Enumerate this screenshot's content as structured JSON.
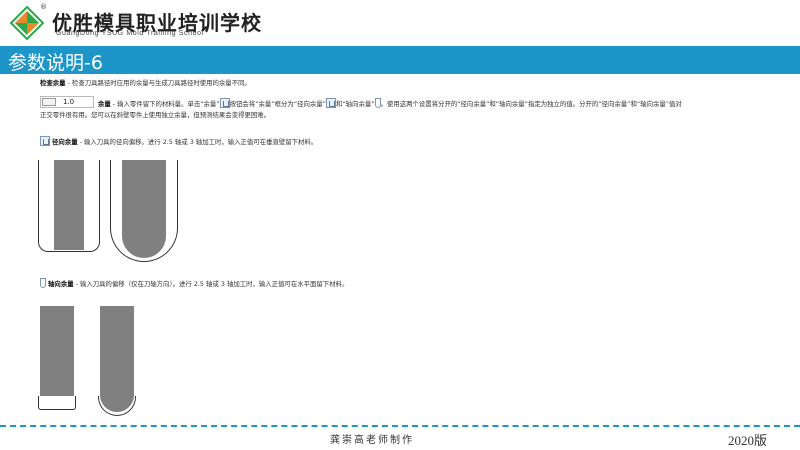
{
  "header": {
    "school_name": "优胜模具职业培训学校",
    "school_subtitle": "GuangDong YSUG Mold Training School",
    "registered_mark": "®",
    "logo_icon": "ysug-logo-icon"
  },
  "title": "参数说明-6",
  "content": {
    "check_label": "检查余量",
    "check_text": " - 检查刀具路径时应用的余量与生成刀具路径时使用的余量不同。",
    "stock_field_value": "1.0",
    "stock_label": "余量",
    "stock_text_1": " - 输入零件留下的材料量。单击“余量”",
    "stock_text_2": "按钮会将“余量”框分为“径向余量”",
    "stock_text_3": "和“轴向余量”",
    "stock_text_4": "。使用这两个设置将分开的“径向余量”和“轴向余量”指定为独立的值。分开的“径向余量”和“轴向余量”值对",
    "stock_text_5": "正交零件很有用。您可以在斜壁零件上使用独立余量，但预测结果会变得更困难。",
    "radial_label": "径向余量",
    "radial_text": " - 输入刀具的径向偏移。进行 2.5 轴或 3 轴加工时，输入正值可在垂直壁留下材料。",
    "axial_label": "轴向余量",
    "axial_text": " - 输入刀具的偏移（仅在刀轴方向）。进行 2.5 轴或 3 轴加工时，输入正值可在水平面留下材料。"
  },
  "footer": {
    "author": "龚崇高老师制作",
    "version": "2020版"
  },
  "colors": {
    "accent": "#1e95c9",
    "tool_fill": "#808080"
  }
}
